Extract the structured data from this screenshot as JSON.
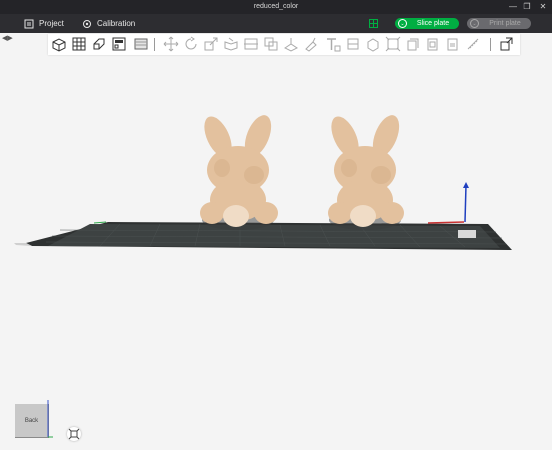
{
  "window": {
    "title": "reduced_color",
    "minimize_icon": "minimize-icon",
    "restore_icon": "restore-icon",
    "close_icon": "close-icon"
  },
  "menu": {
    "items": [
      {
        "label": "Project",
        "icon": "project-file-icon"
      },
      {
        "label": "Calibration",
        "icon": "calibration-icon"
      }
    ],
    "plate_icon": "plate-settings-icon",
    "slice_label": "Slice plate",
    "print_label": "Print plate",
    "accent_color": "#00ae42"
  },
  "toolbar": {
    "groups": [
      [
        "add-object-icon",
        "arrange-grid-icon",
        "auto-orient-icon",
        "layout-icon",
        "split-plate-icon"
      ],
      [
        "move-icon",
        "rotate-icon",
        "scale-icon",
        "lay-on-face-icon",
        "cut-icon",
        "mesh-boolean-icon",
        "support-paint-icon",
        "seam-paint-icon",
        "color-paint-icon",
        "text-icon",
        "assembly-icon",
        "measure-icon",
        "variable-layer-icon",
        "fill-icon",
        "copy-icon",
        "paste-icon",
        "ruler-icon"
      ],
      [
        "view-settings-icon"
      ]
    ]
  },
  "viewport": {
    "model_color": "#e3c19e",
    "objects": [
      {
        "name": "bunny"
      },
      {
        "name": "bunny"
      }
    ],
    "view_cube_label": "Back",
    "zoom_icon": "zoom-fit-icon"
  }
}
